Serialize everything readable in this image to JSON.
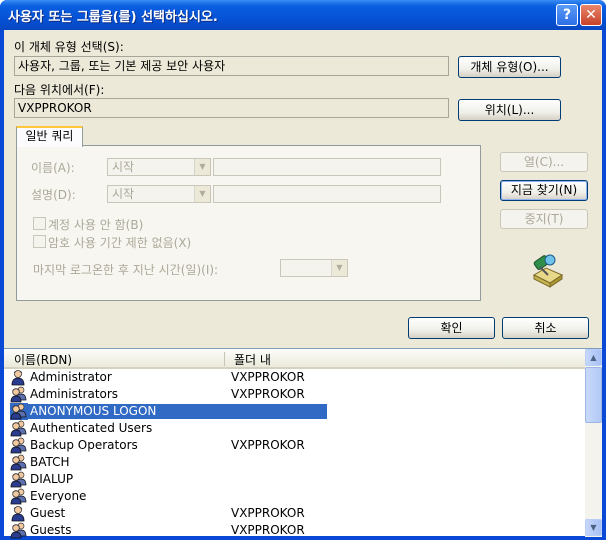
{
  "window": {
    "title": "사용자 또는 그룹을(를) 선택하십시오.",
    "help_label": "?",
    "close_label": "✕"
  },
  "object_type": {
    "label": "이 개체 유형 선택(S):",
    "value": "사용자, 그룹, 또는 기본 제공 보안 사용자",
    "button": "개체 유형(O)..."
  },
  "location": {
    "label": "다음 위치에서(F):",
    "value": "VXPPROKOR",
    "button": "위치(L)..."
  },
  "query": {
    "tab_label": "일반 쿼리",
    "name_label": "이름(A):",
    "name_mode": "시작",
    "desc_label": "설명(D):",
    "desc_mode": "시작",
    "disabled_accounts": "계정 사용 안 함(B)",
    "non_expiring_pw": "암호 사용 기간 제한 없음(X)",
    "days_since_logon": "마지막 로그온한 후 지난 시간(일)(I):"
  },
  "side_buttons": {
    "columns": "열(C)...",
    "find_now": "지금 찾기(N)",
    "stop": "중지(T)"
  },
  "ok_label": "확인",
  "cancel_label": "취소",
  "results": {
    "columns": [
      "이름(RDN)",
      "폴더 내"
    ],
    "rows": [
      {
        "name": "Administrator",
        "folder": "VXPPROKOR",
        "icon": "user-icon"
      },
      {
        "name": "Administrators",
        "folder": "VXPPROKOR",
        "icon": "group-icon"
      },
      {
        "name": "ANONYMOUS LOGON",
        "folder": "",
        "icon": "group-icon",
        "selected": true
      },
      {
        "name": "Authenticated Users",
        "folder": "",
        "icon": "group-icon"
      },
      {
        "name": "Backup Operators",
        "folder": "VXPPROKOR",
        "icon": "group-icon"
      },
      {
        "name": "BATCH",
        "folder": "",
        "icon": "group-icon"
      },
      {
        "name": "DIALUP",
        "folder": "",
        "icon": "group-icon"
      },
      {
        "name": "Everyone",
        "folder": "",
        "icon": "group-icon"
      },
      {
        "name": "Guest",
        "folder": "VXPPROKOR",
        "icon": "user-icon"
      },
      {
        "name": "Guests",
        "folder": "VXPPROKOR",
        "icon": "group-icon"
      }
    ]
  },
  "colors": {
    "title_bar": "#0553d6",
    "dialog_bg": "#ece9d8",
    "selection": "#316ac5"
  }
}
